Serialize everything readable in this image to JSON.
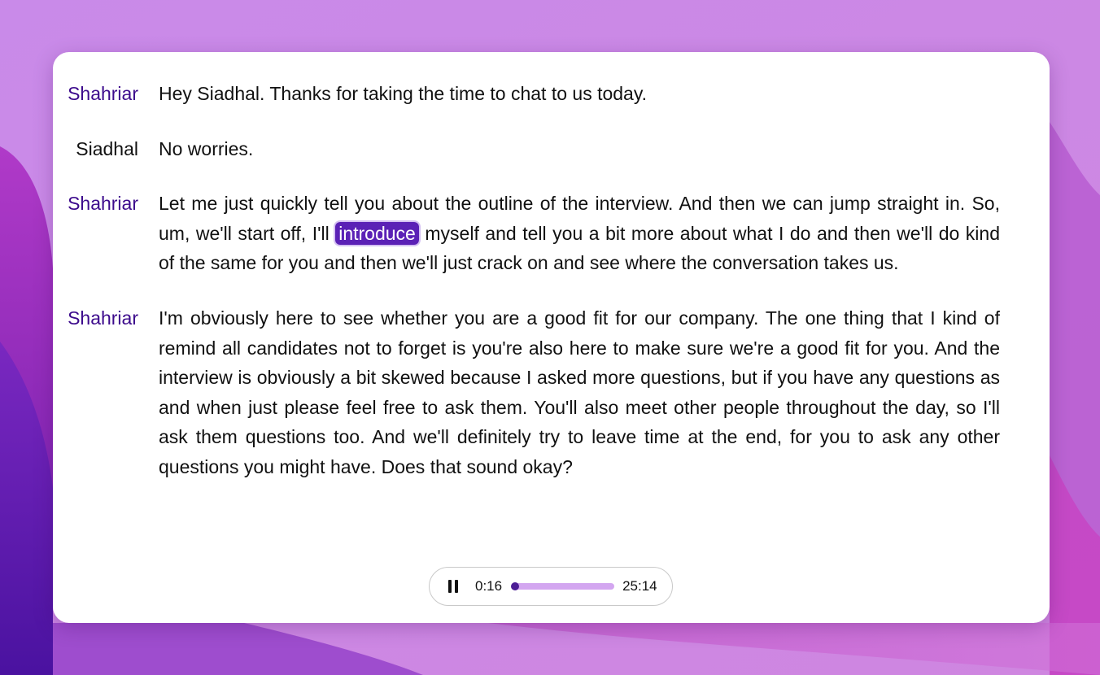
{
  "transcript": [
    {
      "speaker": "Shahriar",
      "role": "interviewer",
      "text": "Hey Siadhal. Thanks for taking the time to chat to us today."
    },
    {
      "speaker": "Siadhal",
      "role": "candidate",
      "text": "No worries."
    },
    {
      "speaker": "Shahriar",
      "role": "interviewer",
      "before": "Let me just quickly tell you about the outline of the interview. And then we can jump straight in. So, um, we'll start off, I'll ",
      "highlight": "introduce",
      "after": " myself and tell you a bit more about what I do and then we'll do kind of the same for you and then we'll just crack on and see where the conversation takes us."
    },
    {
      "speaker": "Shahriar",
      "role": "interviewer",
      "text": "I'm obviously here to see whether you are a good fit for our company. The one thing that I kind of remind all candidates not to forget is you're also here to make sure we're a good fit for you. And the interview is obviously a bit skewed because I asked more questions, but if you have any questions as and when just please feel free to ask them. You'll also meet other people throughout the day, so I'll ask them questions too. And we'll definitely try to leave time at the end, for you to ask any other questions you might have. Does that sound okay?"
    }
  ],
  "player": {
    "state": "playing",
    "button_icon": "pause-icon",
    "elapsed": "0:16",
    "duration": "25:14",
    "progress_fraction": 0.011
  },
  "colors": {
    "interviewer_name": "#3c0a8c",
    "highlight_bg": "#5b21b6",
    "track": "#d3a6f0",
    "thumb": "#4c1d95"
  }
}
